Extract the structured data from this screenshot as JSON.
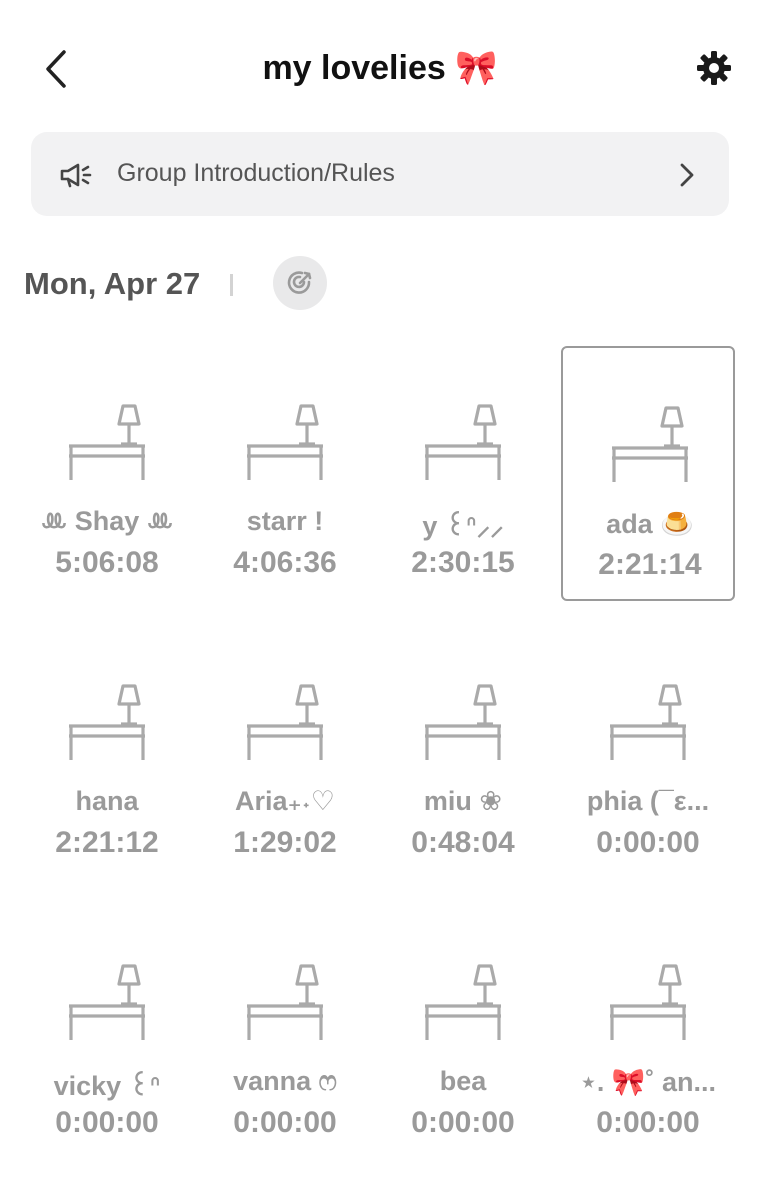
{
  "header": {
    "title": "my lovelies 🎀",
    "back_icon": "chevron-left-icon",
    "settings_icon": "gear-icon"
  },
  "intro": {
    "label": "Group Introduction/Rules",
    "icon": "megaphone-icon",
    "chevron_icon": "chevron-right-icon"
  },
  "date": {
    "label": "Mon, Apr 27",
    "refresh_icon": "refresh-icon"
  },
  "colors": {
    "text_muted": "#9a9a9a",
    "desk_stroke": "#aaaaaa",
    "bar_bg": "#f2f2f3"
  },
  "members": [
    {
      "name": "ꔛ Shay ꔛ",
      "time": "5:06:08",
      "selected": false
    },
    {
      "name": "starr !",
      "time": "4:06:36",
      "selected": false
    },
    {
      "name": "y ꒰ᐢ⸝⸝",
      "time": "2:30:15",
      "selected": false
    },
    {
      "name": "ada 🍮",
      "time": "2:21:14",
      "selected": true
    },
    {
      "name": "hana",
      "time": "2:21:12",
      "selected": false
    },
    {
      "name": "Aria₊˖♡",
      "time": "1:29:02",
      "selected": false
    },
    {
      "name": "miu ❀",
      "time": "0:48:04",
      "selected": false
    },
    {
      "name": "phia (¯ε...",
      "time": "0:00:00",
      "selected": false
    },
    {
      "name": "vicky ꒰ᐢ",
      "time": "0:00:00",
      "selected": false
    },
    {
      "name": "vanna ෆ",
      "time": "0:00:00",
      "selected": false
    },
    {
      "name": "bea",
      "time": "0:00:00",
      "selected": false
    },
    {
      "name": "⋆. 🎀˚ an...",
      "time": "0:00:00",
      "selected": false
    }
  ]
}
